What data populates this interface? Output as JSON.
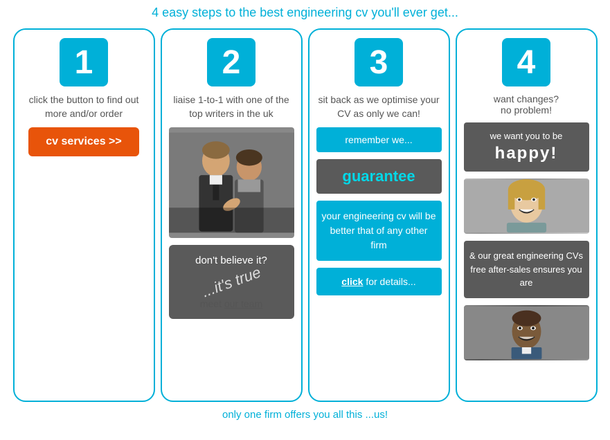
{
  "page": {
    "main_title": "4 easy steps to the best engineering cv you'll ever get...",
    "footer_text": "only one firm offers you all this ...us!"
  },
  "card1": {
    "step_number": "1",
    "description": "click the button to find out more and/or order",
    "button_label": "cv services >>"
  },
  "card2": {
    "step_number": "2",
    "description": "liaise 1-to-1 with one of the top writers in the uk",
    "dont_believe": "don't believe it?",
    "its_true": "...it's true",
    "meet_text": "meet ",
    "our_team_link": "our team"
  },
  "card3": {
    "step_number": "3",
    "description": "sit back as we optimise your CV as only we can!",
    "remember_text": "remember we...",
    "guarantee_label": "guarantee",
    "engineering_text": "your engineering cv will be better that of any other firm",
    "click_text": "click",
    "for_details": " for details..."
  },
  "card4": {
    "step_number": "4",
    "want_changes": "want changes?",
    "no_problem": "no problem!",
    "we_want_text": "we want you to be",
    "happy_text": "happy!",
    "after_sales_text": "& our great engineering CVs free after-sales ensures you are"
  }
}
